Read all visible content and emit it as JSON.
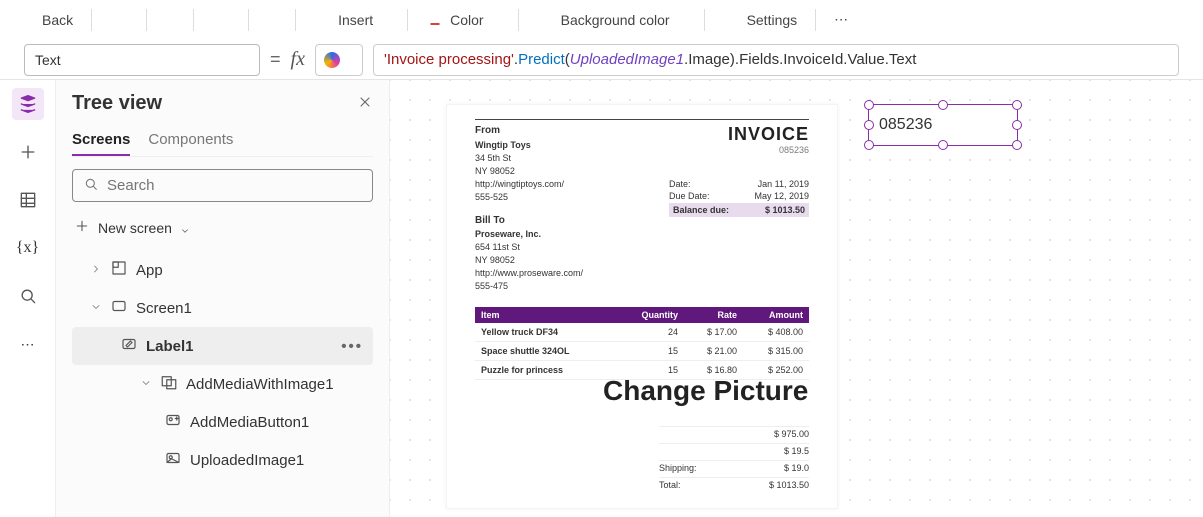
{
  "toolbar": {
    "back_label": "Back",
    "insert_label": "Insert",
    "color_label": "Color",
    "bg_color_label": "Background color",
    "settings_label": "Settings"
  },
  "formula": {
    "property_label": "Text",
    "parts": {
      "prefix": "'Invoice processing'",
      "dot1": ".",
      "method": "Predict",
      "paren_open": "(",
      "arg": "UploadedImage1",
      "arg_suffix": ".Image",
      "paren_close": ")",
      "suffix": ".Fields.InvoiceId.Value.Text"
    }
  },
  "tree": {
    "title": "Tree view",
    "tab_screens": "Screens",
    "tab_components": "Components",
    "search_placeholder": "Search",
    "new_screen_label": "New screen",
    "nodes": {
      "app": "App",
      "screen1": "Screen1",
      "label1": "Label1",
      "add_media_group": "AddMediaWithImage1",
      "add_media_button": "AddMediaButton1",
      "uploaded_image": "UploadedImage1"
    }
  },
  "invoice": {
    "heading": "INVOICE",
    "number": "085236",
    "from_title": "From",
    "from": {
      "name": "Wingtip Toys",
      "addr1": "34 5th St",
      "addr2": "NY 98052",
      "url": "http://wingtiptoys.com/",
      "phone": "555-525"
    },
    "billto_title": "Bill To",
    "billto": {
      "name": "Proseware, Inc.",
      "addr1": "654 11st St",
      "addr2": "NY 98052",
      "url": "http://www.proseware.com/",
      "phone": "555-475"
    },
    "date_label": "Date:",
    "date_value": "Jan 11, 2019",
    "due_label": "Due Date:",
    "due_value": "May 12, 2019",
    "balance_label": "Balance due:",
    "balance_value": "$ 1013.50",
    "table_headers": {
      "item": "Item",
      "qty": "Quantity",
      "rate": "Rate",
      "amount": "Amount"
    },
    "rows": [
      {
        "item": "Yellow truck DF34",
        "qty": "24",
        "rate": "$ 17.00",
        "amount": "$ 408.00"
      },
      {
        "item": "Space shuttle 324OL",
        "qty": "15",
        "rate": "$ 21.00",
        "amount": "$ 315.00"
      },
      {
        "item": "Puzzle for princess",
        "qty": "15",
        "rate": "$ 16.80",
        "amount": "$ 252.00"
      }
    ],
    "totals": {
      "subtotal": "$ 975.00",
      "tax": "$ 19.5",
      "shipping_label": "Shipping:",
      "shipping": "$ 19.0",
      "total_label": "Total:",
      "total": "$ 1013.50"
    },
    "change_picture": "Change Picture"
  },
  "selection": {
    "label_text": "085236"
  }
}
